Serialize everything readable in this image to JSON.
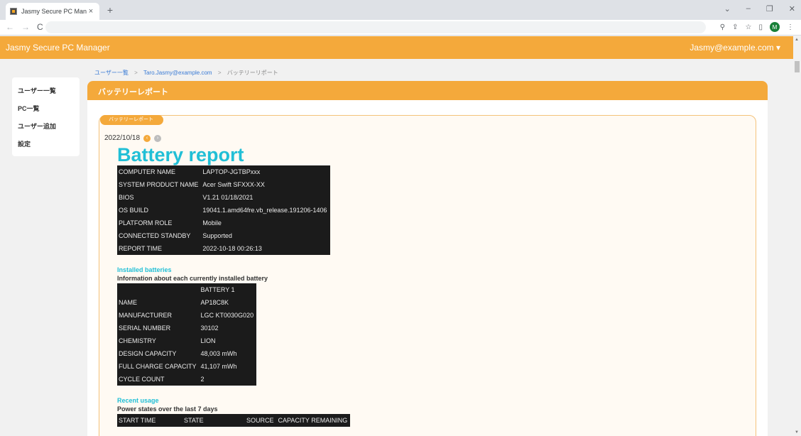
{
  "browser": {
    "tab_title": "Jasmy Secure PC Manager",
    "tab_close": "×",
    "new_tab": "+",
    "window_controls": [
      "⌄",
      "–",
      "❐",
      "✕"
    ],
    "nav": {
      "back": "←",
      "forward": "→",
      "reload": "C"
    },
    "tools": {
      "zoom": "⚲",
      "share": "⇪",
      "star": "☆",
      "sidepanel": "▯",
      "avatar": "M",
      "menu": "⋮"
    }
  },
  "app": {
    "brand": "Jasmy Secure PC Manager",
    "user_menu": "Jasmy@example.com ▾"
  },
  "sidebar": {
    "items": [
      {
        "label": "ユーザー一覧"
      },
      {
        "label": "PC一覧"
      },
      {
        "label": "ユーザー追加"
      },
      {
        "label": "設定"
      }
    ]
  },
  "breadcrumb": {
    "items": [
      "ユーザー一覧",
      "Taro.Jasmy@example.com",
      "バッテリーリポート"
    ],
    "separator": ">"
  },
  "panel": {
    "title": "バッテリーレポート"
  },
  "card": {
    "tag": "バッテリーレポート",
    "date": "2022/10/18",
    "prev_icon": "‹",
    "next_icon": "›"
  },
  "report": {
    "title": "Battery report",
    "system": [
      [
        "COMPUTER NAME",
        "LAPTOP-JGTBPxxx"
      ],
      [
        "SYSTEM PRODUCT NAME",
        "Acer Swift SFXXX-XX"
      ],
      [
        "BIOS",
        "V1.21 01/18/2021"
      ],
      [
        "OS BUILD",
        "19041.1.amd64fre.vb_release.191206-1406"
      ],
      [
        "PLATFORM ROLE",
        "Mobile"
      ],
      [
        "CONNECTED STANDBY",
        "Supported"
      ],
      [
        "REPORT TIME",
        "2022-10-18 00:26:13"
      ]
    ],
    "installed_title": "Installed batteries",
    "installed_sub": "Information about each currently installed battery",
    "battery": [
      [
        "",
        "BATTERY 1"
      ],
      [
        "NAME",
        "AP18C8K"
      ],
      [
        "MANUFACTURER",
        "LGC KT0030G020"
      ],
      [
        "SERIAL NUMBER",
        "30102"
      ],
      [
        "CHEMISTRY",
        "LION"
      ],
      [
        "DESIGN CAPACITY",
        "48,003 mWh"
      ],
      [
        "FULL CHARGE CAPACITY",
        "41,107 mWh"
      ],
      [
        "CYCLE COUNT",
        "2"
      ]
    ],
    "recent_title": "Recent usage",
    "recent_sub": "Power states over the last 7 days",
    "usage_headers": [
      "START TIME",
      "STATE",
      "SOURCE",
      "CAPACITY REMAINING"
    ]
  }
}
